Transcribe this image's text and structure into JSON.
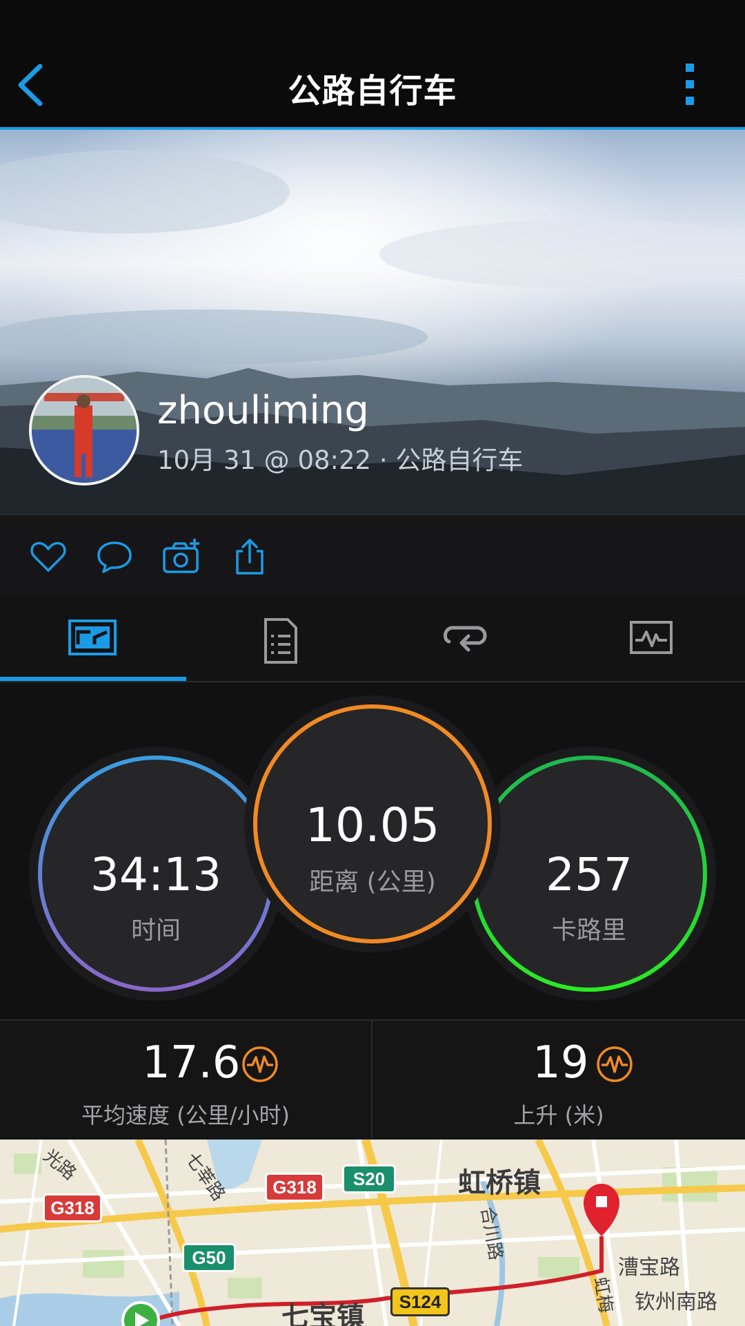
{
  "header": {
    "title": "公路自行车"
  },
  "profile": {
    "username": "zhouliming",
    "meta": "10月 31 @ 08:22 · 公路自行车"
  },
  "actions": [
    "heart-icon",
    "comment-icon",
    "add-photo-icon",
    "share-icon"
  ],
  "tabs": [
    "overview-icon",
    "details-icon",
    "laps-icon",
    "graph-icon"
  ],
  "rings": {
    "time": {
      "value": "34:13",
      "label": "时间"
    },
    "distance": {
      "value": "10.05",
      "label": "距离 (公里)"
    },
    "calories": {
      "value": "257",
      "label": "卡路里"
    }
  },
  "stats": {
    "avg_speed": {
      "value": "17.6",
      "label": "平均速度 (公里/小时)"
    },
    "ascent": {
      "value": "19",
      "label": "上升 (米)"
    }
  },
  "map": {
    "shields": [
      {
        "text": "G318",
        "color": "#d83a3a"
      },
      {
        "text": "G318",
        "color": "#d83a3a"
      },
      {
        "text": "S20",
        "color": "#1a8f6b"
      },
      {
        "text": "G50",
        "color": "#1a8f6b"
      },
      {
        "text": "S124",
        "color": "#f2c51b"
      }
    ],
    "labels": {
      "hongqiao": "虹桥镇",
      "qibao": "七宝镇",
      "caobao": "漕宝路",
      "qinzhou": "钦州南路",
      "hechuan": "合川路",
      "qixin": "七莘路",
      "guang": "光路",
      "hongmei": "虹梅"
    },
    "colors": {
      "route": "#d0202a",
      "end_marker": "#e0222e",
      "start_marker": "#3cb043"
    }
  },
  "colors": {
    "accent": "#1b9be6",
    "ring_time": "#3a9de0",
    "ring_distance": "#f08a24",
    "ring_calories": "#20d63a",
    "stat_icon": "#f08a24"
  }
}
